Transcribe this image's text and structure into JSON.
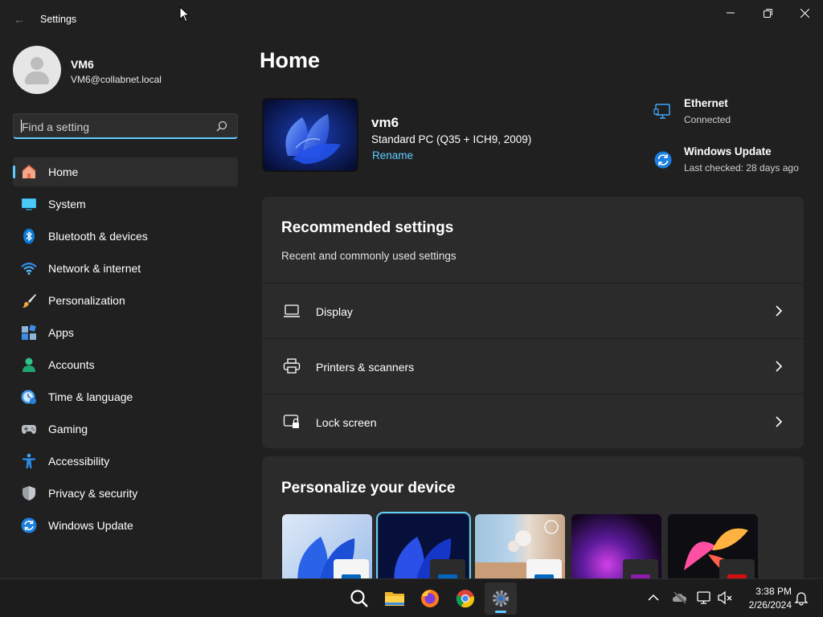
{
  "window": {
    "title": "Settings",
    "back_glyph": "←",
    "minimize_glyph": "—",
    "maximize_glyph": "❐",
    "close_glyph": "✕"
  },
  "profile": {
    "name": "VM6",
    "email": "VM6@collabnet.local"
  },
  "search": {
    "placeholder": "Find a setting",
    "value": ""
  },
  "sidebar": {
    "items": [
      {
        "label": "Home",
        "icon": "home-icon",
        "active": true
      },
      {
        "label": "System",
        "icon": "system-icon"
      },
      {
        "label": "Bluetooth & devices",
        "icon": "bluetooth-icon"
      },
      {
        "label": "Network & internet",
        "icon": "wifi-icon"
      },
      {
        "label": "Personalization",
        "icon": "brush-icon"
      },
      {
        "label": "Apps",
        "icon": "apps-icon"
      },
      {
        "label": "Accounts",
        "icon": "accounts-icon"
      },
      {
        "label": "Time & language",
        "icon": "clock-globe-icon"
      },
      {
        "label": "Gaming",
        "icon": "gamepad-icon"
      },
      {
        "label": "Accessibility",
        "icon": "accessibility-icon"
      },
      {
        "label": "Privacy & security",
        "icon": "shield-icon"
      },
      {
        "label": "Windows Update",
        "icon": "update-icon"
      }
    ]
  },
  "main": {
    "title": "Home",
    "device": {
      "name": "vm6",
      "model": "Standard PC (Q35 + ICH9, 2009)",
      "rename_label": "Rename"
    },
    "status": {
      "ethernet": {
        "title": "Ethernet",
        "subtitle": "Connected"
      },
      "update": {
        "title": "Windows Update",
        "subtitle": "Last checked: 28 days ago"
      }
    },
    "recommended": {
      "title": "Recommended settings",
      "subtitle": "Recent and commonly used settings",
      "rows": [
        {
          "label": "Display",
          "icon": "laptop-icon"
        },
        {
          "label": "Printers & scanners",
          "icon": "printer-icon"
        },
        {
          "label": "Lock screen",
          "icon": "lock-screen-icon"
        }
      ]
    },
    "personalize": {
      "title": "Personalize your device",
      "themes": [
        {
          "name": "light-bloom",
          "accent": "#0067c0"
        },
        {
          "name": "dark-bloom",
          "accent": "#0067c0",
          "selected": true
        },
        {
          "name": "flowers-spotlight",
          "accent": "#0067c0"
        },
        {
          "name": "glow",
          "accent": "#8a1dad"
        },
        {
          "name": "captured-motion",
          "accent": "#d40f0f"
        }
      ]
    }
  },
  "taskbar": {
    "apps": [
      "search-icon",
      "file-explorer-icon",
      "firefox-icon",
      "chrome-icon",
      "settings-icon"
    ],
    "time": "3:38 PM",
    "date": "2/26/2024"
  },
  "colors": {
    "accent": "#60cdff",
    "background": "#202020",
    "card": "#2b2b2b"
  }
}
